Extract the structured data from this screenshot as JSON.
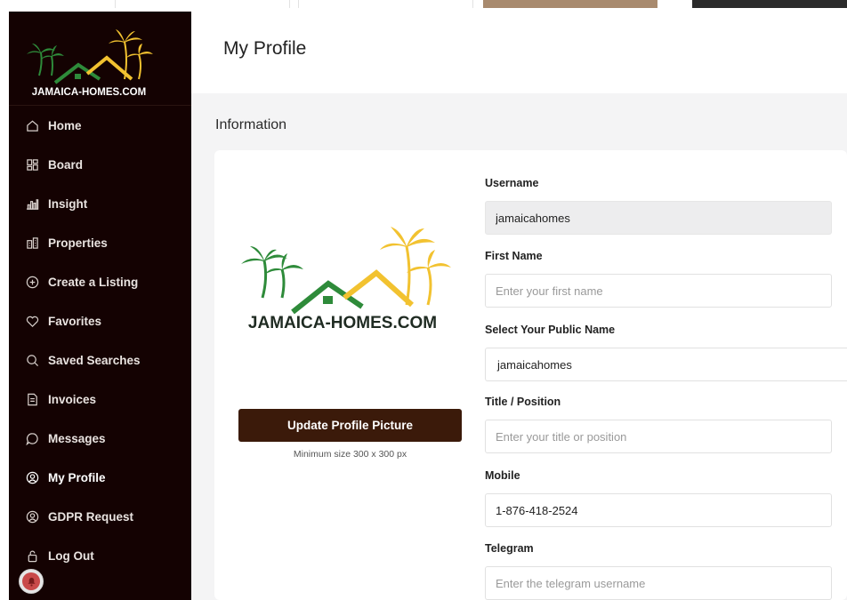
{
  "page": {
    "title": "My Profile",
    "section_title": "Information"
  },
  "brand": {
    "name": "JAMAICA-HOMES.COM",
    "colors": {
      "sidebar_bg": "#140202",
      "button_bg": "#3b1a0a",
      "palm_green": "#2e8b3a",
      "roof_yellow": "#f2c230"
    }
  },
  "sidebar": {
    "items": [
      {
        "label": "Home",
        "icon": "home-icon"
      },
      {
        "label": "Board",
        "icon": "board-icon"
      },
      {
        "label": "Insight",
        "icon": "insight-icon"
      },
      {
        "label": "Properties",
        "icon": "properties-icon"
      },
      {
        "label": "Create a Listing",
        "icon": "plus-circle-icon"
      },
      {
        "label": "Favorites",
        "icon": "heart-icon"
      },
      {
        "label": "Saved Searches",
        "icon": "search-icon"
      },
      {
        "label": "Invoices",
        "icon": "invoice-icon"
      },
      {
        "label": "Messages",
        "icon": "message-icon"
      },
      {
        "label": "My Profile",
        "icon": "user-circle-icon",
        "active": true
      },
      {
        "label": "GDPR Request",
        "icon": "user-circle-icon"
      },
      {
        "label": "Log Out",
        "icon": "lock-icon"
      }
    ]
  },
  "profile_picture": {
    "button_label": "Update Profile Picture",
    "hint": "Minimum size 300 x 300 px"
  },
  "form": {
    "username": {
      "label": "Username",
      "value": "jamaicahomes"
    },
    "first_name": {
      "label": "First Name",
      "value": "",
      "placeholder": "Enter your first name"
    },
    "public_name": {
      "label": "Select Your Public Name",
      "value": "jamaicahomes"
    },
    "title_position": {
      "label": "Title / Position",
      "value": "",
      "placeholder": "Enter your title or position"
    },
    "mobile": {
      "label": "Mobile",
      "value": "1-876-418-2524"
    },
    "telegram": {
      "label": "Telegram",
      "value": "",
      "placeholder": "Enter the telegram username"
    }
  }
}
